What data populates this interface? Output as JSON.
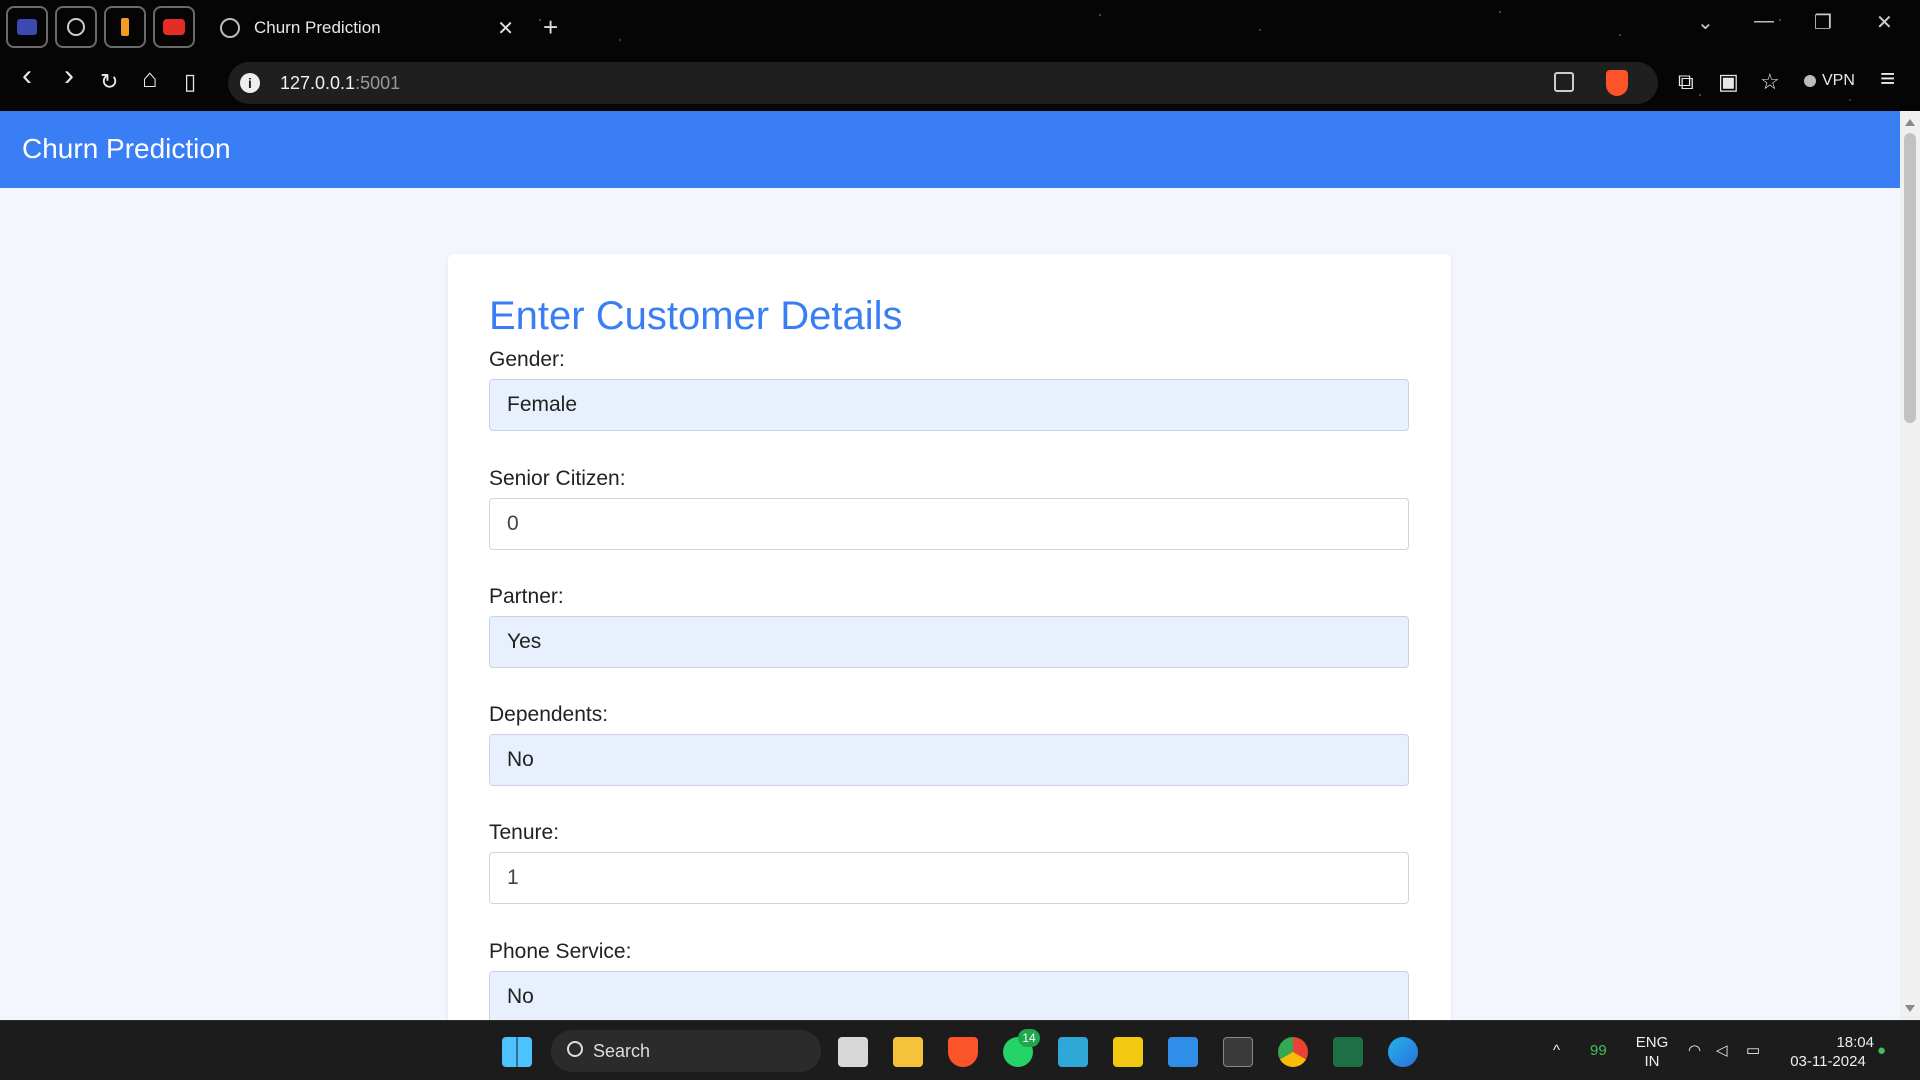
{
  "browser": {
    "tab_title": "Churn Prediction",
    "url_host": "127.0.0.1",
    "url_port": ":5001",
    "vpn_label": "VPN",
    "close_glyph": "✕",
    "new_tab_glyph": "+",
    "back_glyph": "‹",
    "forward_glyph": "›",
    "reload_glyph": "↻",
    "home_glyph": "⌂",
    "bookmark_glyph": "▯",
    "menu_glyph": "≡"
  },
  "app": {
    "title": "Churn Prediction"
  },
  "form": {
    "heading": "Enter Customer Details",
    "fields": [
      {
        "label": "Gender:",
        "value": "Female"
      },
      {
        "label": "Senior Citizen:",
        "value": "0"
      },
      {
        "label": "Partner:",
        "value": "Yes"
      },
      {
        "label": "Dependents:",
        "value": "No"
      },
      {
        "label": "Tenure:",
        "value": "1"
      },
      {
        "label": "Phone Service:",
        "value": "No"
      }
    ]
  },
  "taskbar": {
    "search_label": "Search",
    "whatsapp_badge": "14",
    "tray_number": "99",
    "language_line1": "ENG",
    "language_line2": "IN",
    "time": "18:04",
    "date": "03-11-2024"
  },
  "colors": {
    "accent": "#3a7ef5",
    "select_bg": "#e8f0fe",
    "page_bg": "#f3f7fd"
  }
}
